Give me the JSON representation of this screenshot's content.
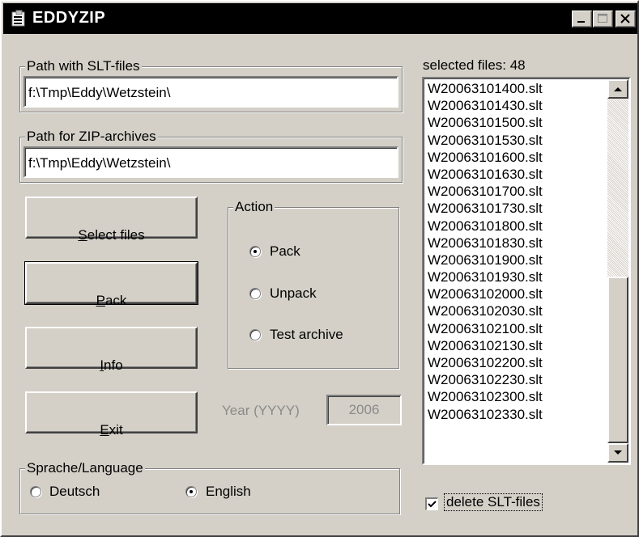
{
  "window": {
    "title": "EDDYZIP"
  },
  "paths": {
    "slt_group_title": "Path with SLT-files",
    "slt_value": "f:\\Tmp\\Eddy\\Wetzstein\\",
    "zip_group_title": "Path for ZIP-archives",
    "zip_value": "f:\\Tmp\\Eddy\\Wetzstein\\"
  },
  "buttons": {
    "select_mnemonic": "S",
    "select_rest": "elect files",
    "pack_mnemonic": "P",
    "pack_rest": "ack",
    "info_mnemonic": "I",
    "info_rest": "nfo",
    "exit_mnemonic": "E",
    "exit_rest": "xit"
  },
  "action": {
    "title": "Action",
    "options": [
      "Pack",
      "Unpack",
      "Test archive"
    ],
    "selected": "Pack"
  },
  "year": {
    "label": "Year (YYYY)",
    "value": "2006"
  },
  "language": {
    "title": "Sprache/Language",
    "options": [
      "Deutsch",
      "English"
    ],
    "selected": "English"
  },
  "files": {
    "header": "selected files: 48",
    "items": [
      "W20063101400.slt",
      "W20063101430.slt",
      "W20063101500.slt",
      "W20063101530.slt",
      "W20063101600.slt",
      "W20063101630.slt",
      "W20063101700.slt",
      "W20063101730.slt",
      "W20063101800.slt",
      "W20063101830.slt",
      "W20063101900.slt",
      "W20063101930.slt",
      "W20063102000.slt",
      "W20063102030.slt",
      "W20063102100.slt",
      "W20063102130.slt",
      "W20063102200.slt",
      "W20063102230.slt",
      "W20063102300.slt",
      "W20063102330.slt"
    ]
  },
  "delete_checkbox": {
    "label": "delete SLT-files",
    "checked": true
  }
}
